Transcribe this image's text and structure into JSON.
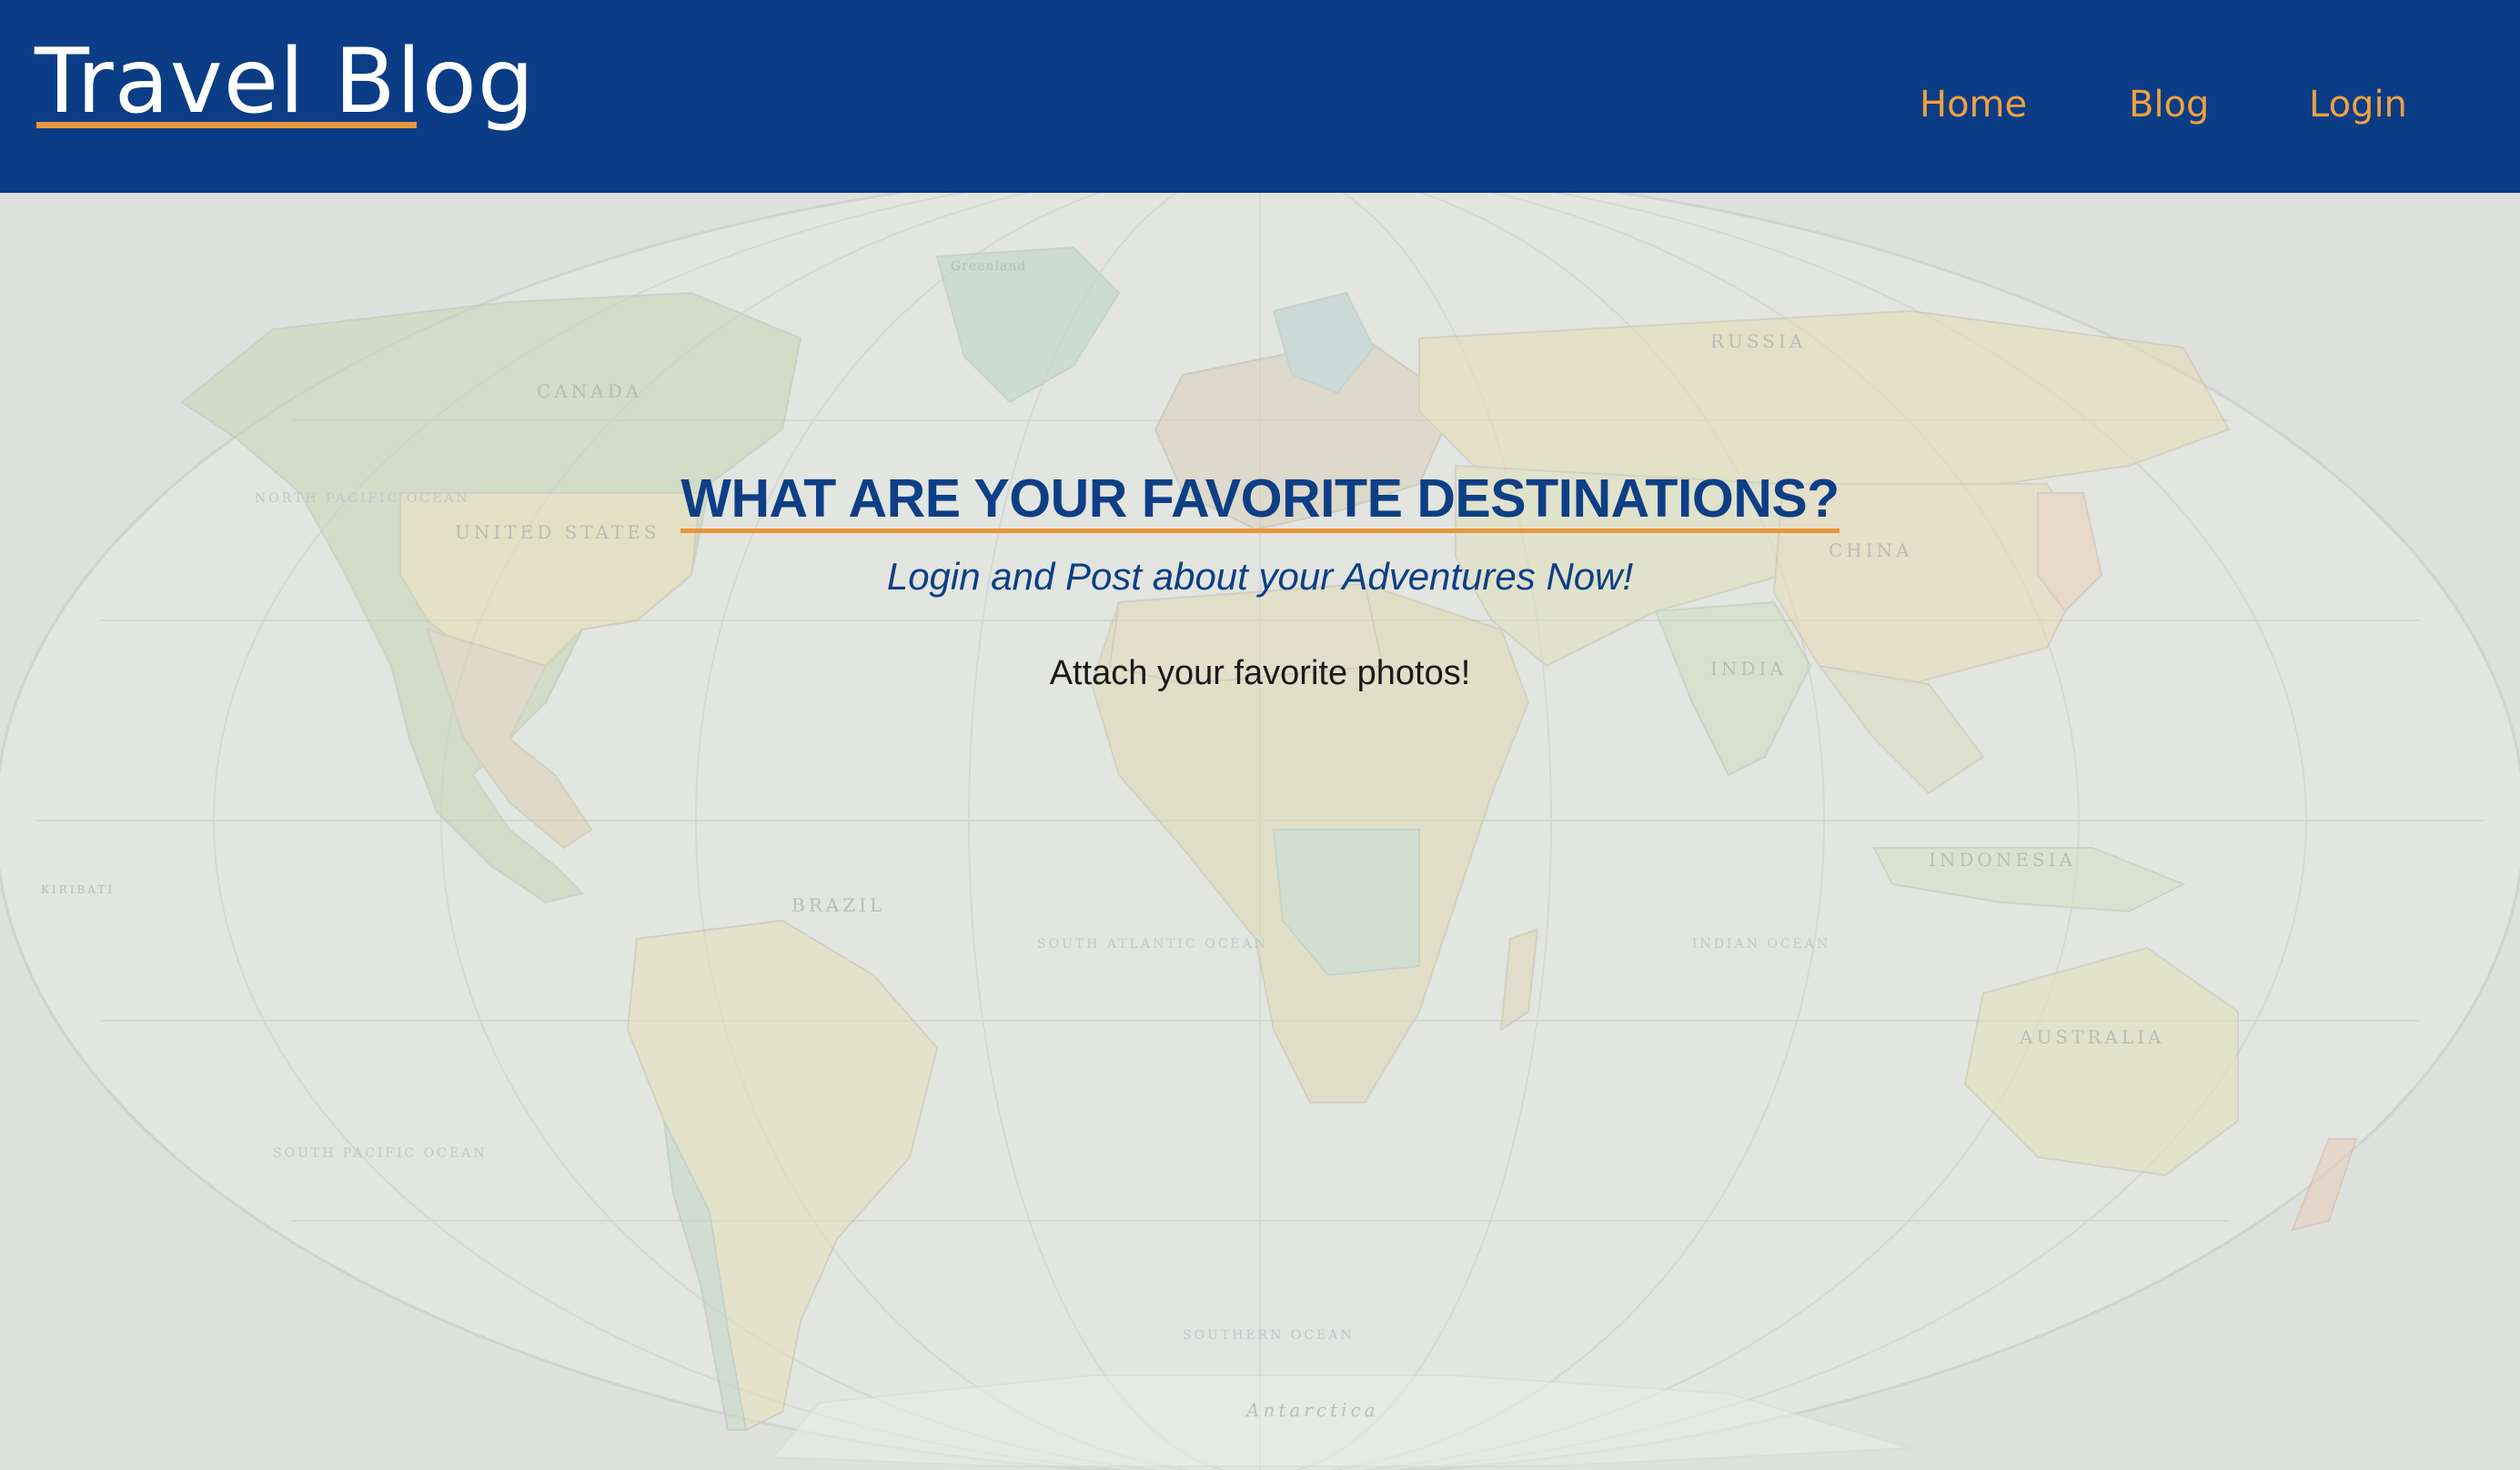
{
  "header": {
    "brand": "Travel Blog",
    "nav": [
      {
        "label": "Home"
      },
      {
        "label": "Blog"
      },
      {
        "label": "Login"
      }
    ]
  },
  "hero": {
    "title": "WHAT ARE YOUR FAVORITE DESTINATIONS?",
    "subtitle": "Login and Post about your Adventures Now!",
    "body": "Attach your favorite photos!"
  },
  "map": {
    "labels": {
      "canada": "CANADA",
      "united_states": "UNITED STATES",
      "brazil": "BRAZIL",
      "russia": "RUSSIA",
      "china": "CHINA",
      "india": "INDIA",
      "australia": "AUSTRALIA",
      "indonesia": "INDONESIA",
      "antarctica": "Antarctica",
      "north_pacific": "NORTH PACIFIC OCEAN",
      "south_pacific": "SOUTH PACIFIC OCEAN",
      "south_atlantic": "SOUTH ATLANTIC OCEAN",
      "indian_ocean": "INDIAN OCEAN",
      "southern_ocean": "SOUTHERN OCEAN",
      "greenland": "Greenland",
      "kiribati": "KIRIBATI"
    }
  },
  "colors": {
    "header_bg": "#0b3d86",
    "accent": "#e8963a",
    "title": "#0e3f86",
    "map_bg": "#dee1dd"
  }
}
